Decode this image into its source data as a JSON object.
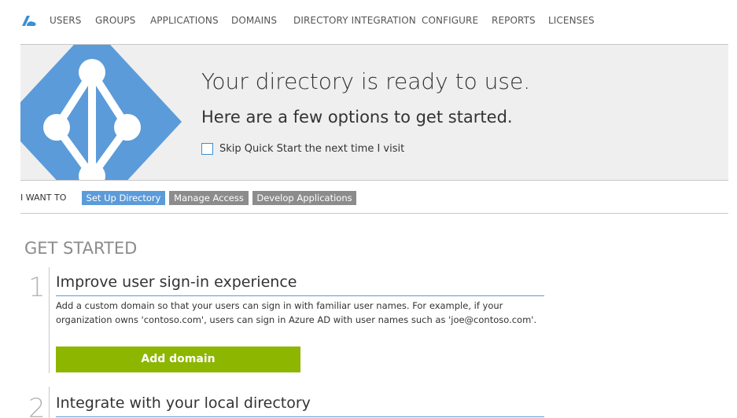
{
  "nav": {
    "items": [
      "USERS",
      "GROUPS",
      "APPLICATIONS",
      "DOMAINS",
      "DIRECTORY INTEGRATION",
      "CONFIGURE",
      "REPORTS",
      "LICENSES"
    ]
  },
  "hero": {
    "title": "Your directory is ready to use.",
    "subtitle": "Here are a few options to get started.",
    "skip_label": "Skip Quick Start the next time I visit",
    "skip_checked": false
  },
  "iwant": {
    "label": "I WANT TO",
    "tabs": [
      {
        "label": "Set Up Directory",
        "active": true
      },
      {
        "label": "Manage Access",
        "active": false
      },
      {
        "label": "Develop Applications",
        "active": false
      }
    ]
  },
  "get_started": {
    "heading": "GET STARTED",
    "steps": [
      {
        "number": "1",
        "title": "Improve user sign-in experience",
        "description": "Add a custom domain so that your users can sign in with familiar user names. For example, if your organization owns 'contoso.com', users can sign in Azure AD with user names such as 'joe@contoso.com'.",
        "button": "Add domain"
      },
      {
        "number": "2",
        "title": "Integrate with your local directory"
      }
    ]
  },
  "colors": {
    "accent_blue": "#5b9bd9",
    "tab_inactive": "#8c8c8c",
    "button_green": "#8db600",
    "hero_bg": "#efefef"
  }
}
